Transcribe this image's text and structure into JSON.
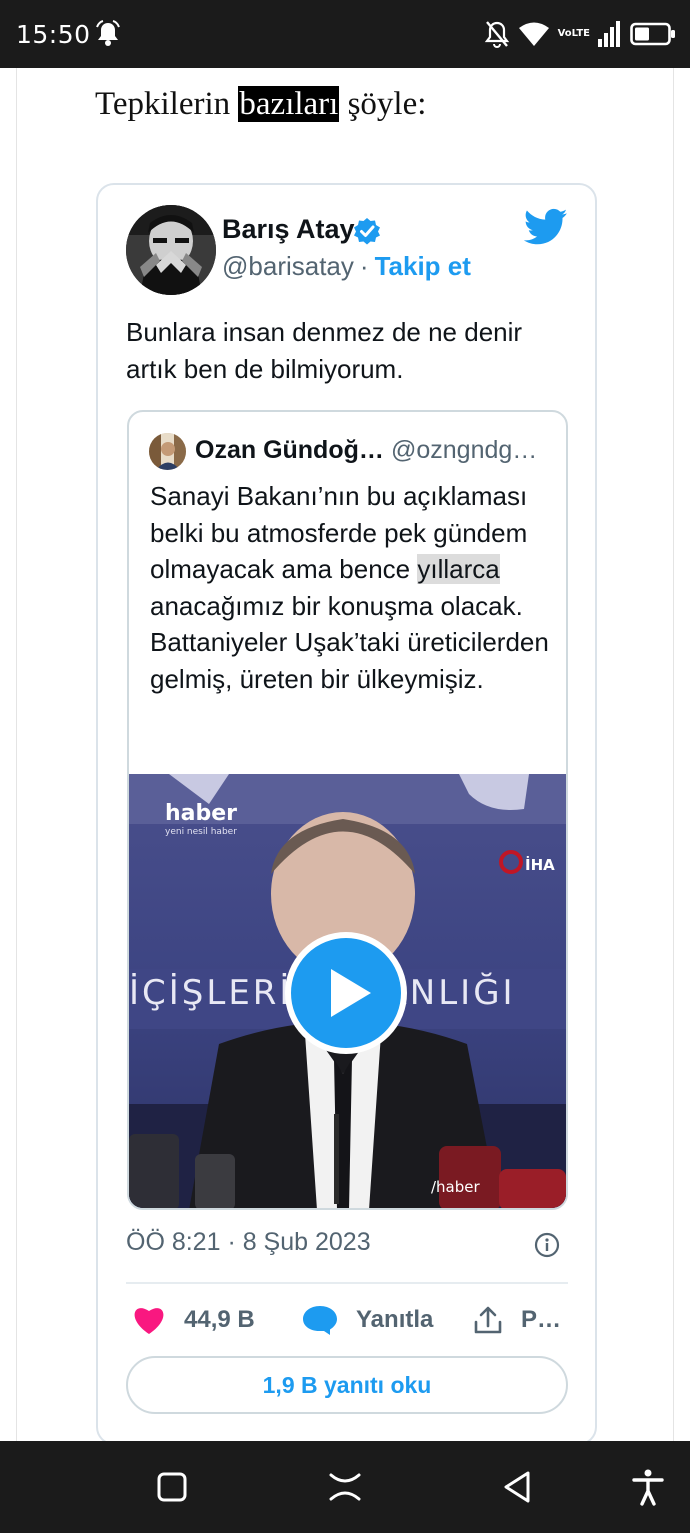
{
  "status_bar": {
    "time": "15:50",
    "network_label": "VoLTE",
    "icons": [
      "alarm-bell-icon",
      "notifications-off-icon",
      "wifi-icon",
      "volte-icon",
      "signal-icon",
      "battery-icon"
    ]
  },
  "article": {
    "intro_before": "Tepkilerin ",
    "intro_highlight": "bazıları",
    "intro_after": " şöyle:"
  },
  "tweet": {
    "author_name": "Barış Atay",
    "author_handle": "@barisatay",
    "separator": "·",
    "follow_label": "Takip et",
    "text": "Bunlara insan denmez de ne denir artık ben de bilmiyorum.",
    "quoted": {
      "author_name": "Ozan Gündoğ…",
      "author_handle": "@ozngndg…",
      "text_before": "Sanayi Bakanı’nın bu açıklaması belki bu atmosferde pek gündem olmayacak ama bence ",
      "text_highlight": "yıllarca",
      "text_after": " anacağımız bir konuşma olacak. Battaniyeler Uşak’taki üreticilerden gelmiş, üreten bir ülkeymişiz.",
      "media": {
        "watermark_left": "haber",
        "watermark_left_sub": "yeni nesil haber",
        "watermark_right": "İHA",
        "banner_text": "İÇİŞLERİ BAKANLIĞI",
        "social_tag": "/haber"
      }
    },
    "timestamp": "ÖÖ 8:21 · 8 Şub 2023",
    "likes_count": "44,9 B",
    "reply_label": "Yanıtla",
    "share_label": "P…",
    "read_replies_label": "1,9 B yanıtı oku"
  },
  "colors": {
    "accent": "#1d9bf0",
    "like": "#f91880",
    "text_primary": "#0f1419",
    "text_secondary": "#536471",
    "system_bar": "#1b1b1b"
  },
  "nav_bar": {
    "icons": [
      "recent-apps-icon",
      "home-icon",
      "back-icon",
      "accessibility-icon"
    ]
  }
}
